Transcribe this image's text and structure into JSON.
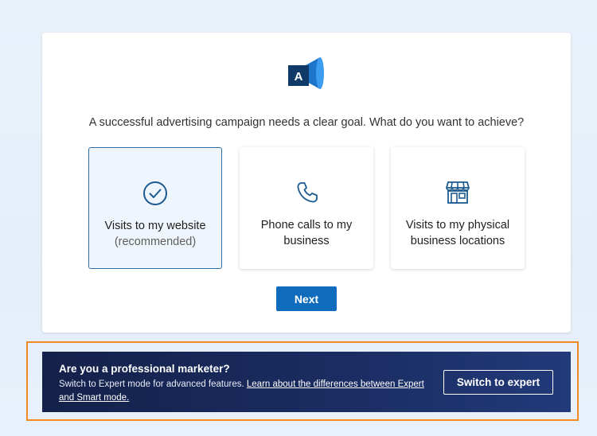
{
  "goal_card": {
    "logo_letter": "A",
    "question": "A successful advertising campaign needs a clear goal. What do you want to achieve?",
    "options": [
      {
        "label": "Visits to my website",
        "sublabel": "(recommended)",
        "icon": "check-circle-icon",
        "selected": true
      },
      {
        "label": "Phone calls to my business",
        "icon": "phone-icon",
        "selected": false
      },
      {
        "label": "Visits to my physical business locations",
        "icon": "storefront-icon",
        "selected": false
      }
    ],
    "next_label": "Next"
  },
  "expert_banner": {
    "title": "Are you a professional marketer?",
    "description": "Switch to Expert mode for advanced features.",
    "link_text": "Learn about the differences between Expert and Smart mode.",
    "button_label": "Switch to expert"
  },
  "colors": {
    "accent": "#0f6cbd",
    "selected_border": "#2f6fa8",
    "banner_bg": "#14214a",
    "highlight": "#f08a24"
  }
}
